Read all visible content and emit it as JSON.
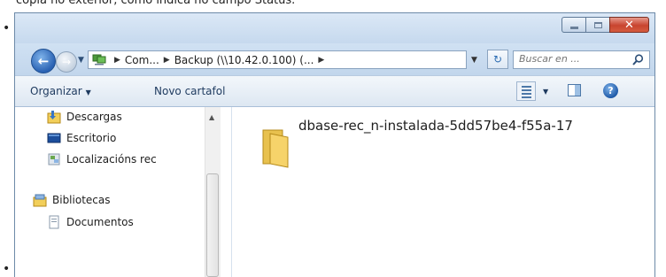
{
  "document": {
    "intro_text": "copia no exterior, como indica no campo Status."
  },
  "window": {
    "close_glyph": "✕"
  },
  "address": {
    "crumbs": [
      "Com...",
      "Backup (\\\\10.42.0.100) (...",
      ""
    ],
    "search_placeholder": "Buscar en ..."
  },
  "toolbar": {
    "organize_label": "Organizar",
    "new_folder_label": "Novo cartafol"
  },
  "sidebar": {
    "items": [
      {
        "label": "Descargas",
        "icon": "downloads-folder-icon"
      },
      {
        "label": "Escritorio",
        "icon": "desktop-icon"
      },
      {
        "label": "Localizacións rec",
        "icon": "recent-places-icon"
      },
      {
        "label": "Bibliotecas",
        "icon": "libraries-icon"
      },
      {
        "label": "Documentos",
        "icon": "documents-icon"
      }
    ]
  },
  "content": {
    "items": [
      {
        "name": "dbase-rec_n-instalada-5dd57be4-f55a-17",
        "icon": "folder-icon"
      }
    ]
  },
  "colors": {
    "title_bar": "#c6d9ee",
    "close_button": "#c8442f",
    "accent_blue": "#2a62b3"
  }
}
